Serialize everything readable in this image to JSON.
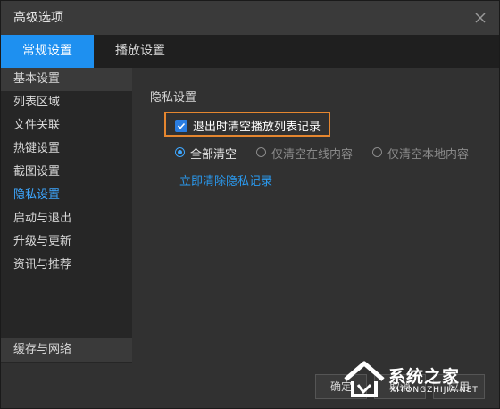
{
  "window": {
    "title": "高级选项"
  },
  "tabs": [
    {
      "label": "常规设置",
      "active": true
    },
    {
      "label": "播放设置",
      "active": false
    }
  ],
  "sidebar": {
    "items": [
      {
        "label": "基本设置"
      },
      {
        "label": "列表区域"
      },
      {
        "label": "文件关联"
      },
      {
        "label": "热键设置"
      },
      {
        "label": "截图设置"
      },
      {
        "label": "隐私设置"
      },
      {
        "label": "启动与退出"
      },
      {
        "label": "升级与更新"
      },
      {
        "label": "资讯与推荐"
      }
    ],
    "bottom_item": "缓存与网络"
  },
  "privacy": {
    "section_title": "隐私设置",
    "checkbox_label": "退出时清空播放列表记录",
    "checkbox_checked": true,
    "radios": [
      {
        "label": "全部清空",
        "checked": true
      },
      {
        "label": "仅清空在线内容",
        "checked": false
      },
      {
        "label": "仅清空本地内容",
        "checked": false
      }
    ],
    "clear_link": "立即清除隐私记录"
  },
  "footer": {
    "ok_label": "确定",
    "cancel_label": "取消",
    "apply_label": "应用"
  },
  "watermark": {
    "text": "系统之家",
    "sub": "XITONGZHIJIA.NET"
  },
  "colors": {
    "accent": "#1e90f0",
    "highlight_border": "#e5862f",
    "link": "#2a9af0"
  }
}
